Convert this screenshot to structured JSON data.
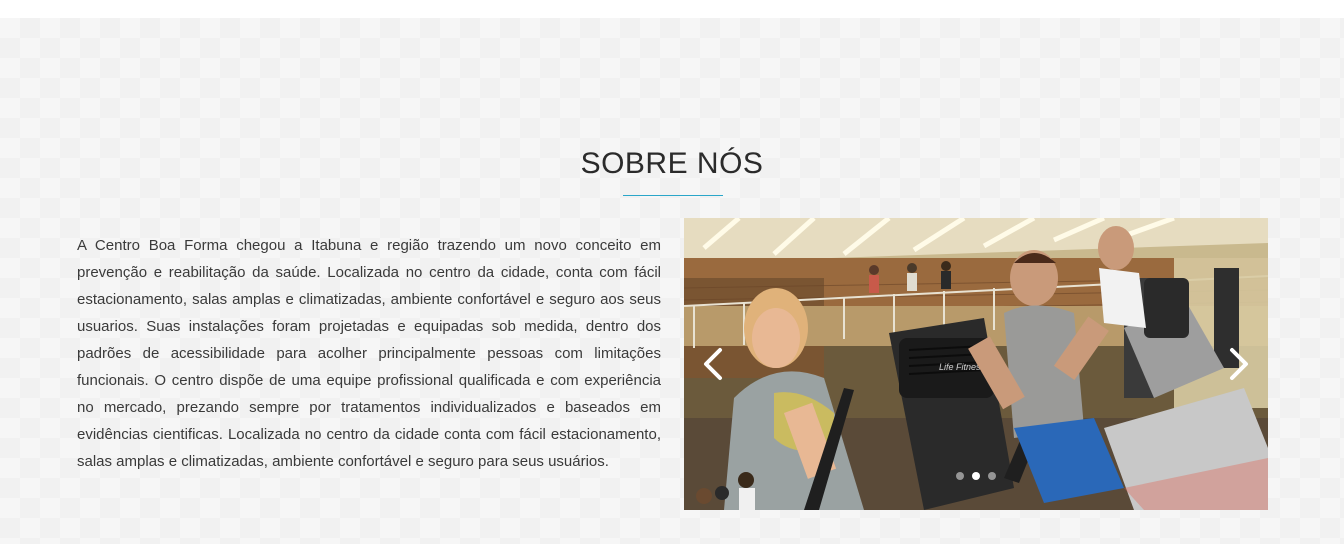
{
  "about": {
    "title": "SOBRE NÓS",
    "text": "A Centro Boa Forma chegou a Itabuna e região trazendo um novo conceito em prevenção e reabilitação da saúde. Localizada no centro da cidade, conta com fácil estacionamento, salas amplas e climatizadas, ambiente confortável e seguro aos seus usuarios. Suas instalações foram projetadas e equipadas sob medida, dentro dos padrões de acessibilidade para acolher principalmente pessoas com limitações funcionais. O centro dispõe de uma equipe profissional qualificada e com experiência no mercado, prezando sempre por tratamentos individualizados e baseados em evidências cientificas. Localizada no centro da cidade conta com fácil estacionamento, salas amplas e climatizadas, ambiente confortável e seguro para seus usuários."
  },
  "carousel": {
    "prev_icon": "chevron-left-icon",
    "next_icon": "chevron-right-icon",
    "slide_count": 3,
    "active_slide": 2,
    "photo_subject": "people exercising on elliptical machines in a gym",
    "machine_brand_text": "Life Fitness"
  },
  "colors": {
    "accent": "#2aa6c9",
    "title_text": "#2b2b2b",
    "body_text": "#3a3a3a",
    "section_bg": "#f6f6f6"
  }
}
